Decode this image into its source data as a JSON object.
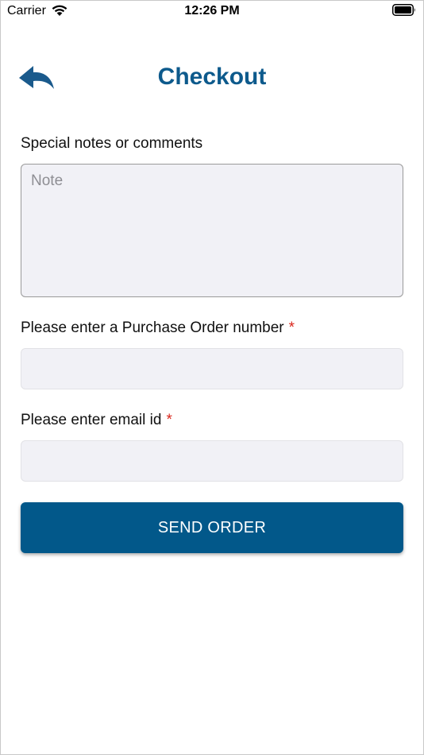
{
  "status_bar": {
    "carrier": "Carrier",
    "time": "12:26 PM",
    "wifi_icon": "wifi-icon",
    "battery_icon": "battery-icon"
  },
  "header": {
    "title": "Checkout",
    "back_icon": "back-arrow-icon"
  },
  "form": {
    "notes_label": "Special notes or comments",
    "notes_placeholder": "Note",
    "notes_value": "",
    "po_label": "Please enter a Purchase Order number",
    "po_value": "",
    "email_label": "Please enter email id",
    "email_value": "",
    "required_marker": "*",
    "submit_label": "SEND ORDER"
  },
  "colors": {
    "accent": "#0d5a8c",
    "button": "#02588a",
    "required": "#d9261c",
    "field_bg": "#f1f1f6"
  }
}
